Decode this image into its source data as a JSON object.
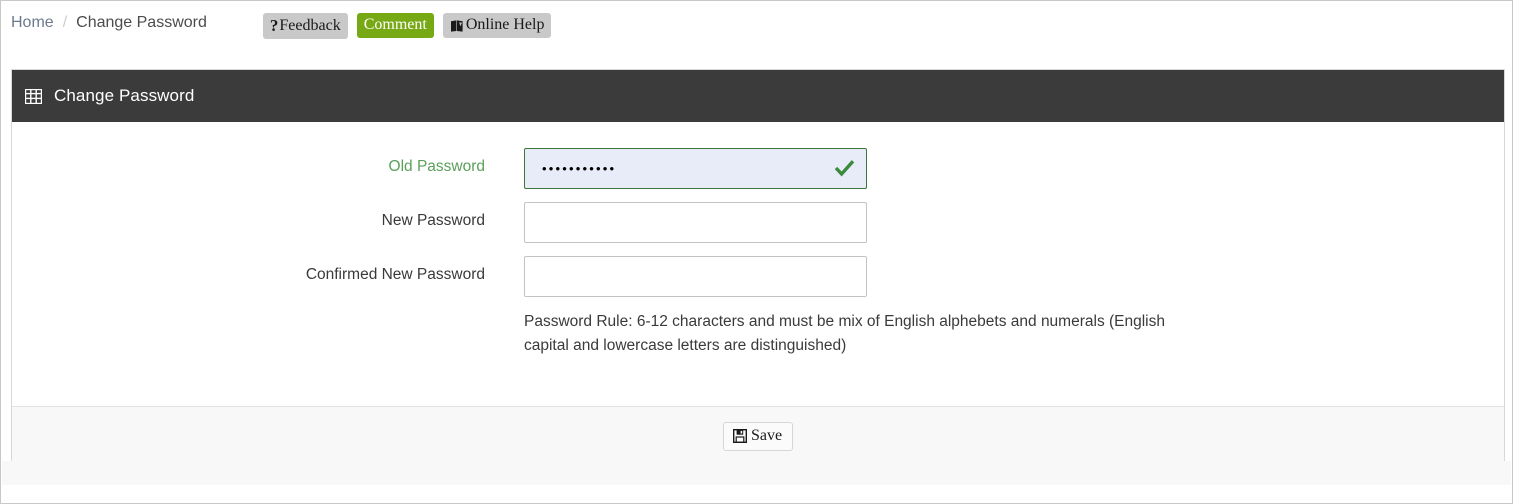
{
  "breadcrumb": {
    "home_label": "Home",
    "separator": "/",
    "current_label": "Change Password"
  },
  "toolbar": {
    "feedback_icon": "question-mark-icon",
    "feedback_label": "Feedback",
    "comment_label": "Comment",
    "online_help_icon": "book-icon",
    "online_help_label": "Online Help",
    "comment_color": "#76a914",
    "grey_button_color": "#c9c9c9"
  },
  "panel": {
    "header_icon": "grid-icon",
    "title": "Change Password",
    "header_bg": "#3b3b3b"
  },
  "form": {
    "fields": [
      {
        "label": "Old Password",
        "value": "•••••••••••",
        "placeholder": "",
        "state": "valid",
        "state_icon": "check-icon",
        "label_color": "#5aa05a",
        "field_bg": "#e7ecf8",
        "field_border": "#3c763d"
      },
      {
        "label": "New Password",
        "value": "",
        "placeholder": "",
        "state": "default",
        "state_icon": "",
        "label_color": "#3a3a3a",
        "field_bg": "#ffffff",
        "field_border": "#c3c3c3"
      },
      {
        "label": "Confirmed New Password",
        "value": "",
        "placeholder": "",
        "state": "default",
        "state_icon": "",
        "label_color": "#3a3a3a",
        "field_bg": "#ffffff",
        "field_border": "#c3c3c3"
      }
    ],
    "rule_text": "Password Rule: 6-12 characters and must be mix of English alphebets and numerals (English capital and lowercase letters are distinguished)"
  },
  "footer": {
    "save_icon": "floppy-disk-icon",
    "save_label": "Save"
  }
}
